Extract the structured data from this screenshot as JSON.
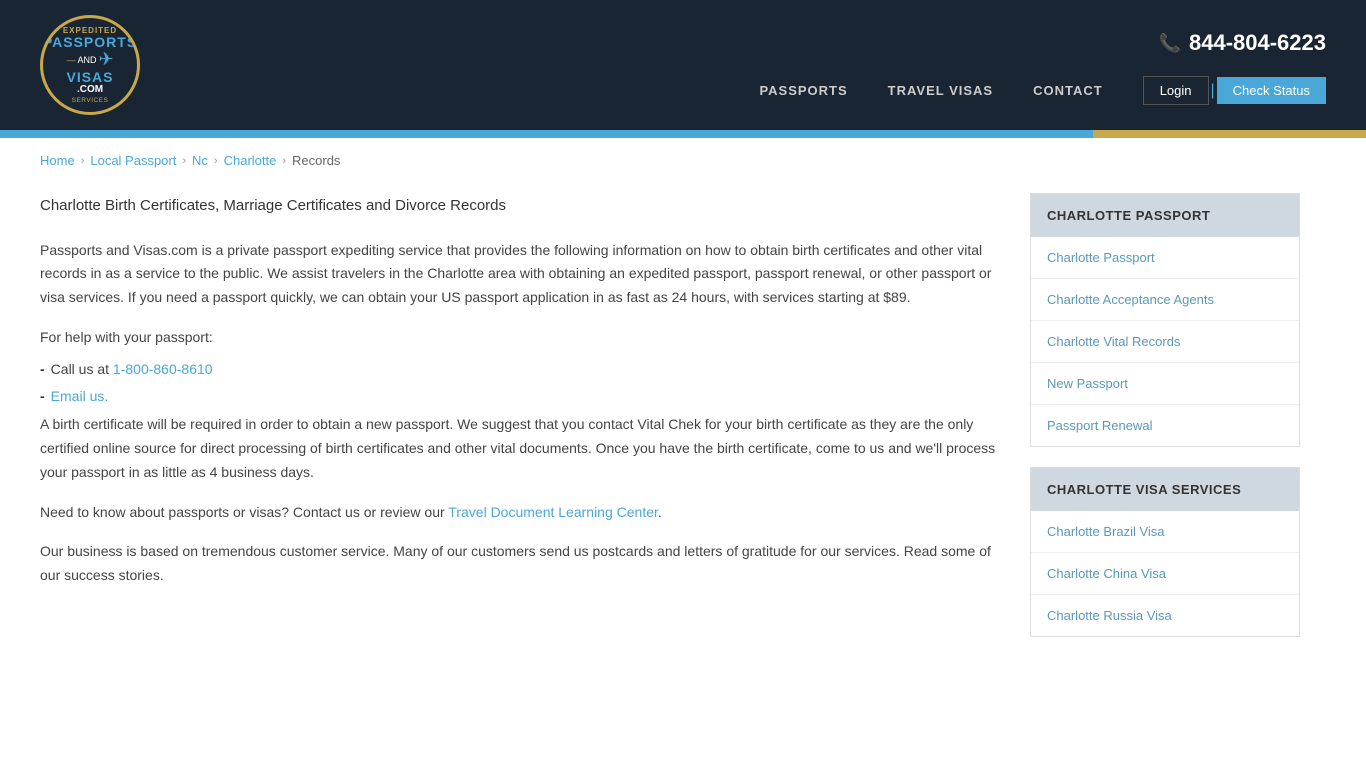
{
  "header": {
    "phone": "844-804-6223",
    "nav_items": [
      {
        "label": "PASSPORTS",
        "id": "passports"
      },
      {
        "label": "TRAVEL VISAS",
        "id": "travel-visas"
      },
      {
        "label": "CONTACT",
        "id": "contact"
      }
    ],
    "login_label": "Login",
    "check_status_label": "Check Status",
    "logo_line1": "PASSPORTS",
    "logo_line2": "AND",
    "logo_line3": "VISAS",
    "logo_line4": ".COM",
    "logo_sub": "EXPEDITED SERVICES"
  },
  "breadcrumb": {
    "home": "Home",
    "local_passport": "Local Passport",
    "nc": "Nc",
    "charlotte": "Charlotte",
    "current": "Records"
  },
  "content": {
    "title": "Charlotte Birth Certificates, Marriage Certificates and Divorce Records",
    "paragraph1": "Passports and Visas.com is a private passport expediting service that provides the following information on how to obtain birth certificates and other vital records in as a service to the public. We assist travelers in the Charlotte area with obtaining an expedited passport, passport renewal, or other passport or visa services.  If you need a passport quickly, we can obtain your US passport application in as fast as 24 hours, with services starting at $89.",
    "help_heading": "For help with your passport:",
    "bullet1_prefix": "Call us at ",
    "bullet1_phone": "1-800-860-8610",
    "bullet2_prefix": "Email us.",
    "paragraph2": " A birth certificate will be required in order to obtain a new passport. We suggest that you contact Vital Chek for your birth certificate as they are the only certified online source for direct processing of birth certificates and other vital documents. Once you have the birth certificate, come to us and we'll process your passport in as little as 4 business days.",
    "paragraph3": "Need to know about passports or visas?  Contact us or review our ",
    "travel_doc_link": "Travel Document Learning Center",
    "paragraph3_end": ".",
    "paragraph4": "Our business is based on tremendous customer service.  Many of our customers send us postcards and letters of gratitude for our services.  Read some of our success stories."
  },
  "sidebar": {
    "passport_section_header": "CHARLOTTE PASSPORT",
    "passport_links": [
      {
        "label": "Charlotte Passport",
        "id": "charlotte-passport"
      },
      {
        "label": "Charlotte Acceptance Agents",
        "id": "charlotte-acceptance-agents"
      },
      {
        "label": "Charlotte Vital Records",
        "id": "charlotte-vital-records"
      },
      {
        "label": "New Passport",
        "id": "new-passport"
      },
      {
        "label": "Passport Renewal",
        "id": "passport-renewal"
      }
    ],
    "visa_section_header": "CHARLOTTE VISA SERVICES",
    "visa_links": [
      {
        "label": "Charlotte Brazil Visa",
        "id": "charlotte-brazil-visa"
      },
      {
        "label": "Charlotte China Visa",
        "id": "charlotte-china-visa"
      },
      {
        "label": "Charlotte Russia Visa",
        "id": "charlotte-russia-visa"
      }
    ]
  }
}
